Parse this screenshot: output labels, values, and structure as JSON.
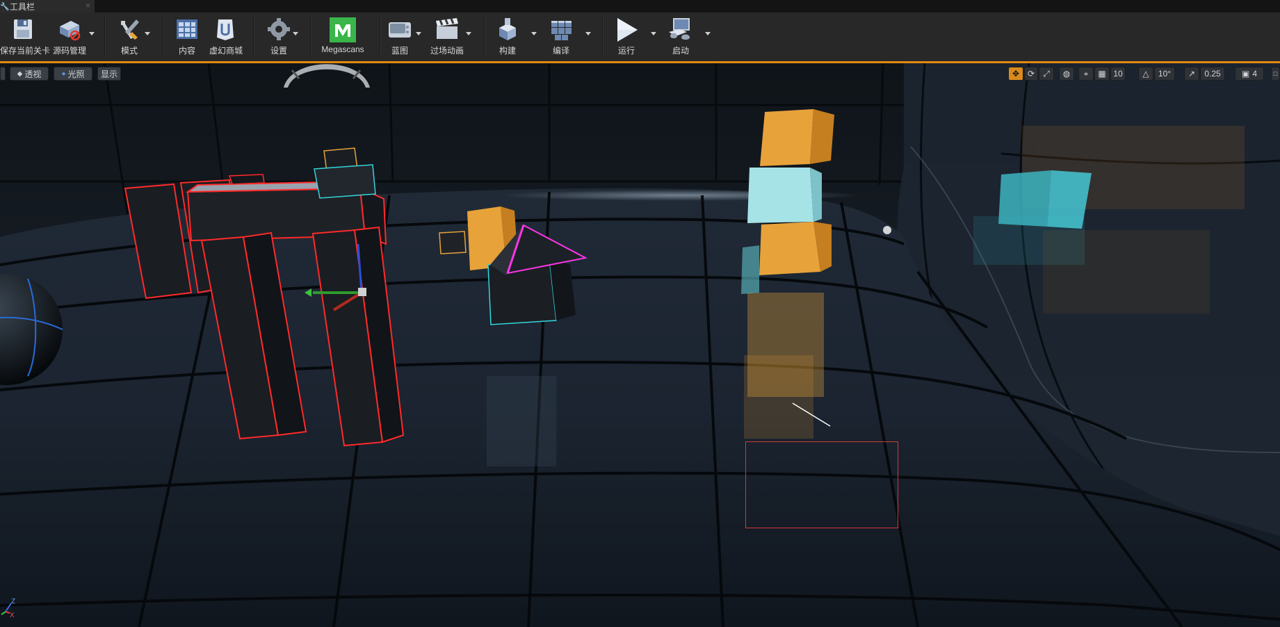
{
  "tab": {
    "title": "工具栏",
    "icon": "wrench-icon",
    "close_glyph": "×"
  },
  "toolbar": {
    "buttons": [
      {
        "id": "save",
        "label": "保存当前关卡",
        "icon": "save-icon",
        "dropdown": false
      },
      {
        "id": "source",
        "label": "源码管理",
        "icon": "source-control-icon",
        "dropdown": true
      },
      {
        "id": "modes",
        "label": "模式",
        "icon": "modes-icon",
        "dropdown": true
      },
      {
        "id": "content",
        "label": "内容",
        "icon": "content-icon",
        "dropdown": false
      },
      {
        "id": "market",
        "label": "虚幻商城",
        "icon": "marketplace-icon",
        "dropdown": false
      },
      {
        "id": "settings",
        "label": "设置",
        "icon": "settings-gear-icon",
        "dropdown": true
      },
      {
        "id": "megascans",
        "label": "Megascans",
        "icon": "megascans-icon",
        "dropdown": false
      },
      {
        "id": "blueprint",
        "label": "蓝图",
        "icon": "blueprint-icon",
        "dropdown": true
      },
      {
        "id": "cinematics",
        "label": "过场动画",
        "icon": "clapperboard-icon",
        "dropdown": true
      },
      {
        "id": "build",
        "label": "构建",
        "icon": "build-icon",
        "dropdown": true
      },
      {
        "id": "compile",
        "label": "编译",
        "icon": "compile-icon",
        "dropdown": true
      },
      {
        "id": "play",
        "label": "运行",
        "icon": "play-icon",
        "dropdown": true
      },
      {
        "id": "launch",
        "label": "启动",
        "icon": "launch-icon",
        "dropdown": true
      }
    ],
    "accent_color": "#e08a12"
  },
  "viewport": {
    "left_buttons": [
      {
        "label": "透视",
        "icon": "perspective-icon"
      },
      {
        "label": "光照",
        "icon": "lit-sphere-icon"
      },
      {
        "label": "显示",
        "icon": ""
      }
    ],
    "right_controls": {
      "translate_active": true,
      "grid_snap_value": "10",
      "rotate_snap_value": "10°",
      "scale_snap_value": "0.25",
      "camera_speed_value": "4"
    },
    "axis_labels": {
      "z": "Z",
      "x": "X"
    },
    "colors": {
      "orange_box": "#e8a23a",
      "cyan_box": "#9fe0e4",
      "selection_red": "#ff2a2a",
      "selection_cyan": "#35d6dc",
      "selection_magenta": "#ff35e6",
      "marquee": "#d23a3a"
    }
  }
}
